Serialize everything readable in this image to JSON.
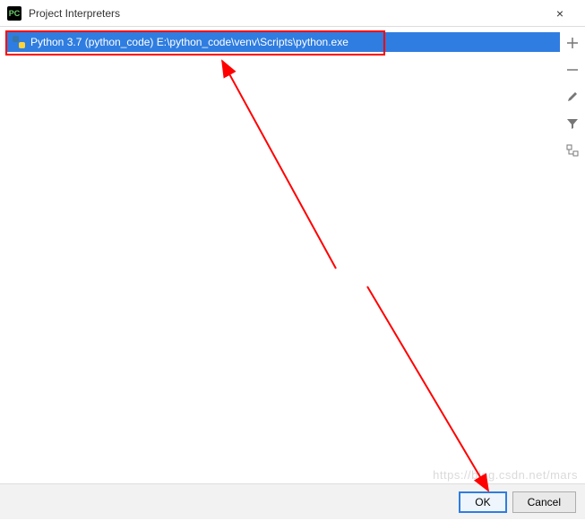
{
  "titlebar": {
    "app_icon_text": "PC",
    "title": "Project Interpreters",
    "close_label": "×"
  },
  "interpreter_list": {
    "items": [
      {
        "label": "Python 3.7 (python_code) E:\\python_code\\venv\\Scripts\\python.exe"
      }
    ]
  },
  "side_tools": {
    "add_label": "+",
    "remove_label": "−",
    "edit_label": "✎",
    "filter_label": "⏷",
    "tree_label": "⊟"
  },
  "footer": {
    "ok_label": "OK",
    "cancel_label": "Cancel"
  },
  "watermark": "https://blog.csdn.net/mars"
}
